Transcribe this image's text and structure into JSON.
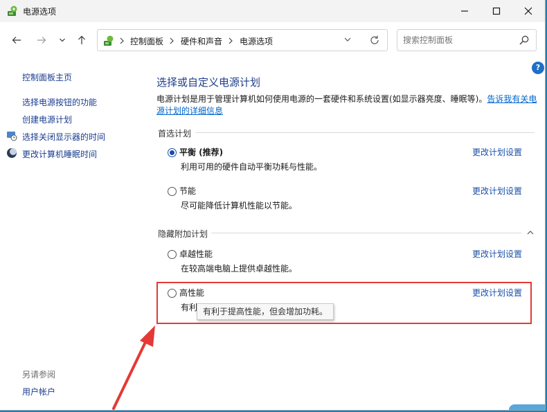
{
  "window": {
    "title": "电源选项"
  },
  "address_bar": {
    "crumbs": [
      "控制面板",
      "硬件和声音",
      "电源选项"
    ]
  },
  "search": {
    "placeholder": "搜索控制面板"
  },
  "left_pane": {
    "home": "控制面板主页",
    "items": [
      "选择电源按钮的功能",
      "创建电源计划",
      "选择关闭显示器的时间",
      "更改计算机睡眠时间"
    ],
    "see_also_title": "另请参阅",
    "see_also_items": [
      "用户帐户"
    ]
  },
  "main": {
    "heading": "选择或自定义电源计划",
    "description": "电源计划是用于管理计算机如何使用电源的一套硬件和系统设置(如显示器亮度、睡眠等)。",
    "description_link": "告诉我有关电源计划的详细信息",
    "preferred_title": "首选计划",
    "hidden_title": "隐藏附加计划",
    "change_label": "更改计划设置",
    "plans": [
      {
        "name": "平衡 (推荐)",
        "desc": "利用可用的硬件自动平衡功耗与性能。",
        "selected": true
      },
      {
        "name": "节能",
        "desc": "尽可能降低计算机性能以节能。",
        "selected": false
      },
      {
        "name": "卓越性能",
        "desc": "在较高端电脑上提供卓越性能。",
        "selected": false
      },
      {
        "name": "高性能",
        "desc": "有利于提高性能，但会增加功耗。",
        "selected": false
      }
    ],
    "tooltip": "有利于提高性能，但会增加功耗。"
  },
  "colors": {
    "accent": "#1a4fa8",
    "highlight": "#e53935",
    "heading": "#1e3e8a"
  }
}
